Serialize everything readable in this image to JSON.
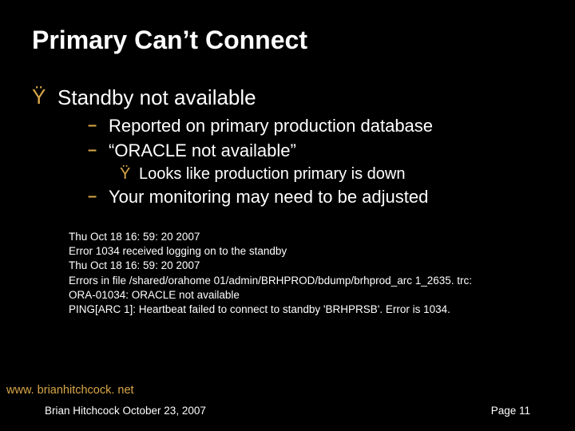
{
  "title": "Primary Can’t Connect",
  "bullet1": {
    "mark": "Ÿ",
    "text": "Standby not available"
  },
  "sub": {
    "a": {
      "dash": "–",
      "text": "Reported on primary production database"
    },
    "b": {
      "dash": "–",
      "text": "“ORACLE not available”"
    },
    "b1": {
      "mark": "Ÿ",
      "text": "Looks like production primary is down"
    },
    "c": {
      "dash": "–",
      "text": "Your monitoring may need to be adjusted"
    }
  },
  "log": {
    "l1": "Thu Oct 18 16: 59: 20 2007",
    "l2": "Error 1034 received logging on to the standby",
    "l3": "Thu Oct 18 16: 59: 20 2007",
    "l4": "Errors in file /shared/orahome 01/admin/BRHPROD/bdump/brhprod_arc 1_2635. trc:",
    "l5": "ORA-01034: ORACLE not available",
    "l6": "PING[ARC 1]: Heartbeat failed to connect to standby 'BRHPRSB'. Error is 1034."
  },
  "footer": {
    "web": "www. brianhitchcock. net",
    "author": "Brian Hitchcock  October 23, 2007",
    "page": "Page 11"
  }
}
